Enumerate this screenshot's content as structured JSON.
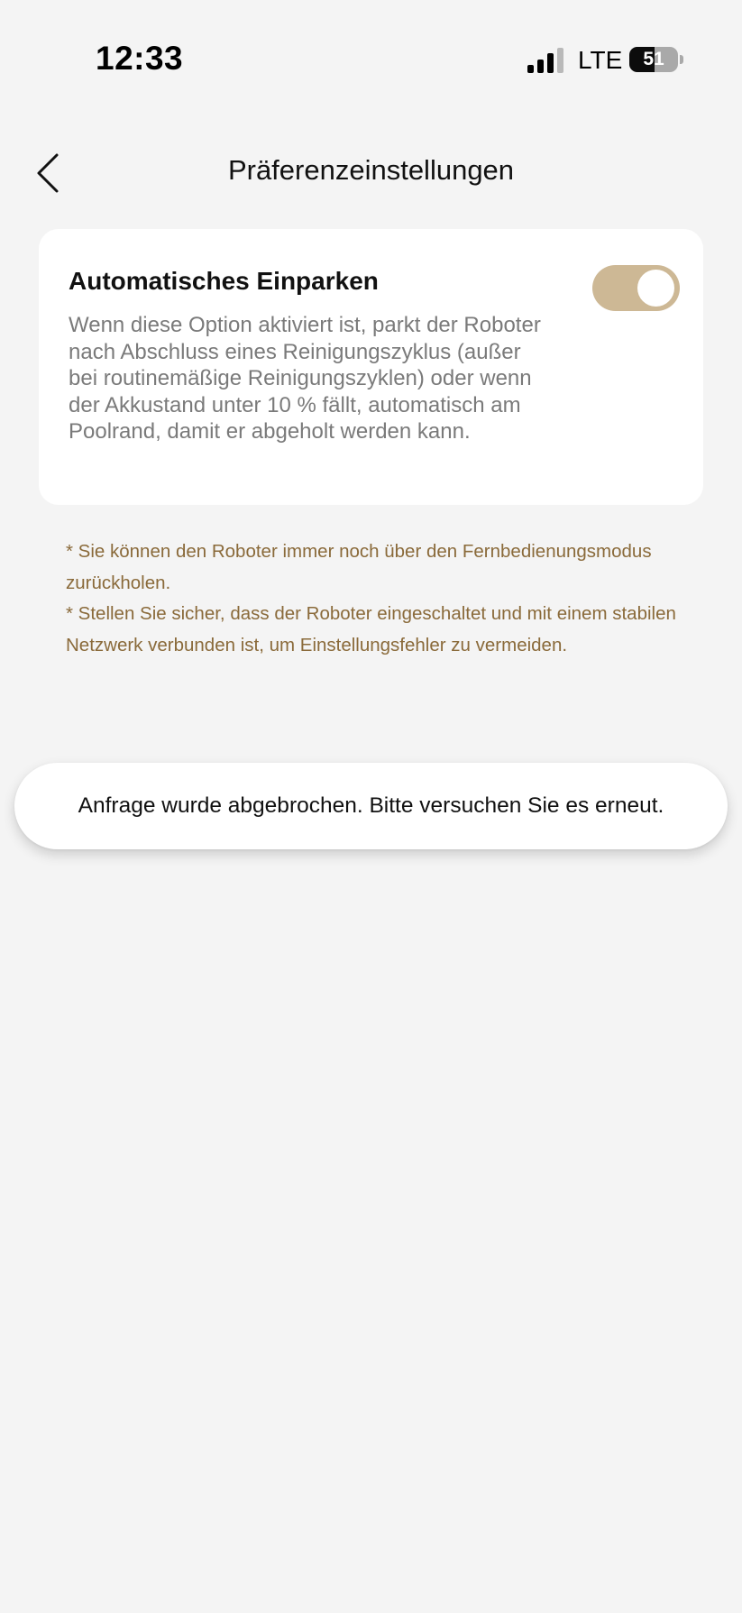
{
  "status_bar": {
    "time": "12:33",
    "network": "LTE",
    "battery_level": "51",
    "battery_fraction": 0.51,
    "signal_bars_total": 4,
    "signal_bars_active": 3,
    "signal_icon": "cellular-signal-icon",
    "battery_icon": "battery-icon"
  },
  "header": {
    "title": "Präferenzeinstellungen",
    "back_icon": "chevron-left-icon"
  },
  "setting": {
    "title": "Automatisches Einparken",
    "description": "Wenn diese Option aktiviert ist, parkt der Roboter nach Abschluss eines Reinigungszyklus (außer bei routinemäßige Reinigungszyklen) oder wenn der Akkustand unter 10 % fällt, automatisch am Poolrand, damit er abgeholt werden kann.",
    "enabled": true
  },
  "notes": [
    "* Sie können den Roboter immer noch über den Fernbedienungsmodus zurückholen.",
    "* Stellen Sie sicher, dass der Roboter eingeschaltet und mit einem stabilen Netzwerk verbunden ist, um Einstellungsfehler zu vermeiden."
  ],
  "toast": {
    "message": "Anfrage wurde abgebrochen. Bitte versuchen Sie es erneut."
  },
  "colors": {
    "background": "#f4f4f4",
    "card": "#ffffff",
    "toggle_on": "#cdb895",
    "note_text": "#8a6a3a",
    "description_text": "#7a7a7a"
  }
}
